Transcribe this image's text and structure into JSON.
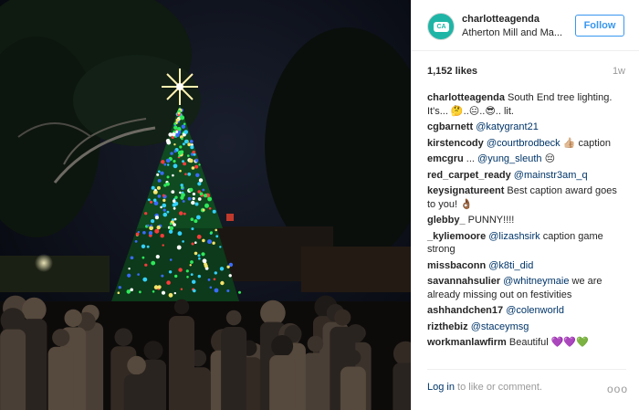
{
  "post": {
    "photo_label": "tree-lighting-photo",
    "header": {
      "username": "charlotteagenda",
      "location": "Atherton Mill and Ma...",
      "avatar_text": "CA",
      "follow_label": "Follow"
    },
    "likes": "1,152 likes",
    "age": "1w",
    "comments": [
      {
        "user": "charlotteagenda",
        "text": " South End tree lighting. It's... 🤔..😐..😎.. lit.",
        "mention": ""
      },
      {
        "user": "cgbarnett",
        "text": "",
        "mention": "@katygrant21"
      },
      {
        "user": "kirstencody",
        "text": " 👍🏼 caption",
        "mention": "@courtbrodbeck"
      },
      {
        "user": "emcgru",
        "pre": " ... ",
        "text": " 😔",
        "mention": "@yung_sleuth"
      },
      {
        "user": "red_carpet_ready",
        "text": "",
        "mention": "@mainstr3am_q"
      },
      {
        "user": "keysignatureent",
        "text": " Best caption award goes to you! 👌🏾",
        "mention": ""
      },
      {
        "user": "glebby_",
        "text": " PUNNY!!!!",
        "mention": ""
      },
      {
        "user": "_kyliemoore",
        "text": " caption game strong",
        "mention": "@lizashsirk"
      },
      {
        "user": "missbaconn",
        "text": "",
        "mention": "@k8ti_did"
      },
      {
        "user": "savannahsulier",
        "text": " we are already missing out on festivities",
        "mention": "@whitneymaie"
      },
      {
        "user": "ashhandchen17",
        "text": "",
        "mention": "@colenworld"
      },
      {
        "user": "rizthebiz",
        "text": "",
        "mention": "@staceymsg"
      },
      {
        "user": "workmanlawfirm",
        "text": " Beautiful 💜💜💚",
        "mention": ""
      }
    ],
    "footer": {
      "login_label": "Log in",
      "rest": " to like or comment.",
      "more_label": "ooo"
    }
  },
  "colors": {
    "link": "#003569",
    "follow": "#3897f0",
    "avatar": "#1fb5a6"
  }
}
